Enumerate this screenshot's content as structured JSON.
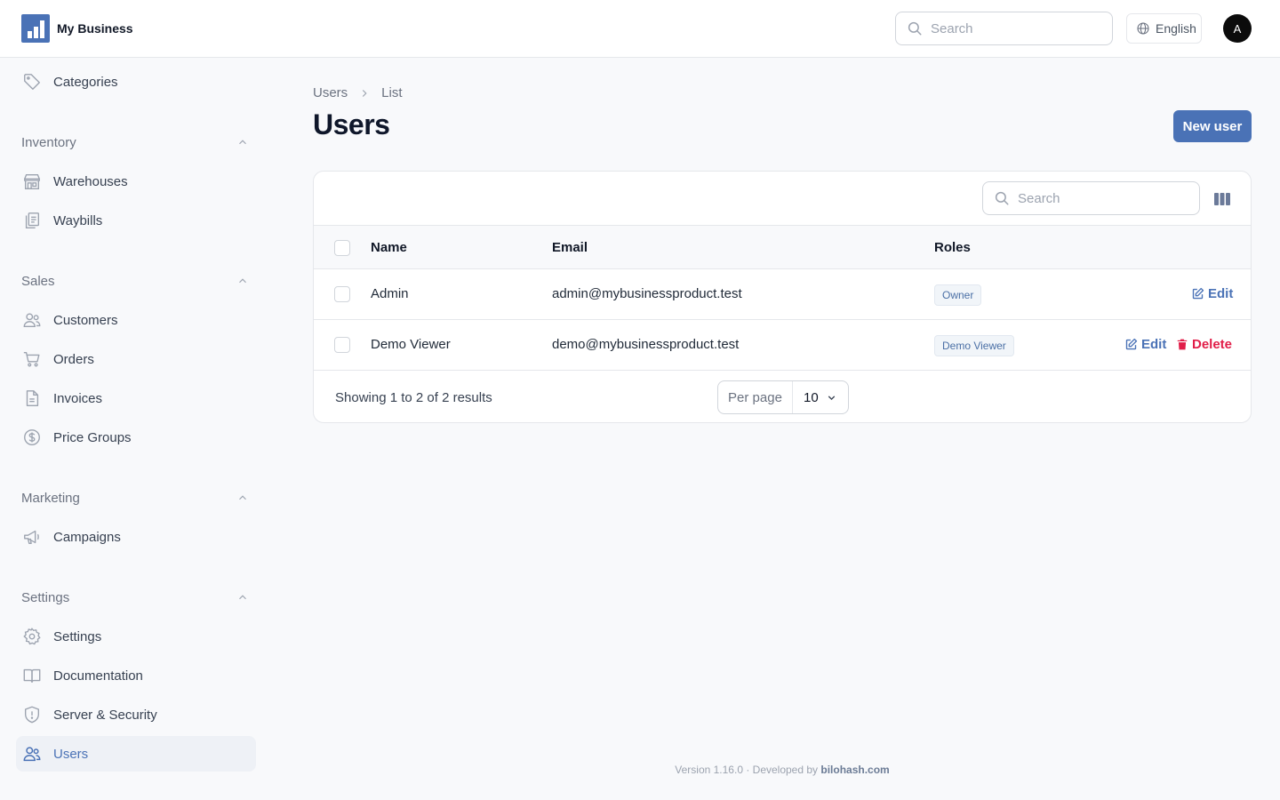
{
  "app": {
    "name": "My Business"
  },
  "header": {
    "search_placeholder": "Search",
    "language": "English",
    "avatar_initial": "A"
  },
  "sidebar": {
    "top_items": [
      {
        "label": "Categories",
        "icon": "tag-icon"
      }
    ],
    "groups": [
      {
        "label": "Inventory",
        "items": [
          {
            "label": "Warehouses",
            "icon": "building-storefront-icon"
          },
          {
            "label": "Waybills",
            "icon": "clipboard-document-icon"
          }
        ]
      },
      {
        "label": "Sales",
        "items": [
          {
            "label": "Customers",
            "icon": "users-icon"
          },
          {
            "label": "Orders",
            "icon": "shopping-cart-icon"
          },
          {
            "label": "Invoices",
            "icon": "document-text-icon"
          },
          {
            "label": "Price Groups",
            "icon": "currency-dollar-icon"
          }
        ]
      },
      {
        "label": "Marketing",
        "items": [
          {
            "label": "Campaigns",
            "icon": "megaphone-icon"
          }
        ]
      },
      {
        "label": "Settings",
        "items": [
          {
            "label": "Settings",
            "icon": "cog-icon"
          },
          {
            "label": "Documentation",
            "icon": "book-open-icon"
          },
          {
            "label": "Server & Security",
            "icon": "shield-exclamation-icon"
          },
          {
            "label": "Users",
            "icon": "users-icon",
            "active": true
          }
        ]
      }
    ]
  },
  "breadcrumb": [
    "Users",
    "List"
  ],
  "page": {
    "title": "Users",
    "new_button": "New user"
  },
  "table": {
    "search_placeholder": "Search",
    "columns": [
      "Name",
      "Email",
      "Roles"
    ],
    "rows": [
      {
        "name": "Admin",
        "email": "admin@mybusinessproduct.test",
        "role": "Owner",
        "actions": [
          "Edit"
        ]
      },
      {
        "name": "Demo Viewer",
        "email": "demo@mybusinessproduct.test",
        "role": "Demo Viewer",
        "actions": [
          "Edit",
          "Delete"
        ]
      }
    ],
    "showing": "Showing 1 to 2 of 2 results",
    "per_page_label": "Per page",
    "per_page_value": "10"
  },
  "footer": {
    "version": "Version 1.16.0 · Developed by ",
    "credit": "bilohash.com"
  },
  "colors": {
    "accent": "#4a72b6",
    "danger": "#e11d48",
    "background": "#f8f9fb"
  }
}
